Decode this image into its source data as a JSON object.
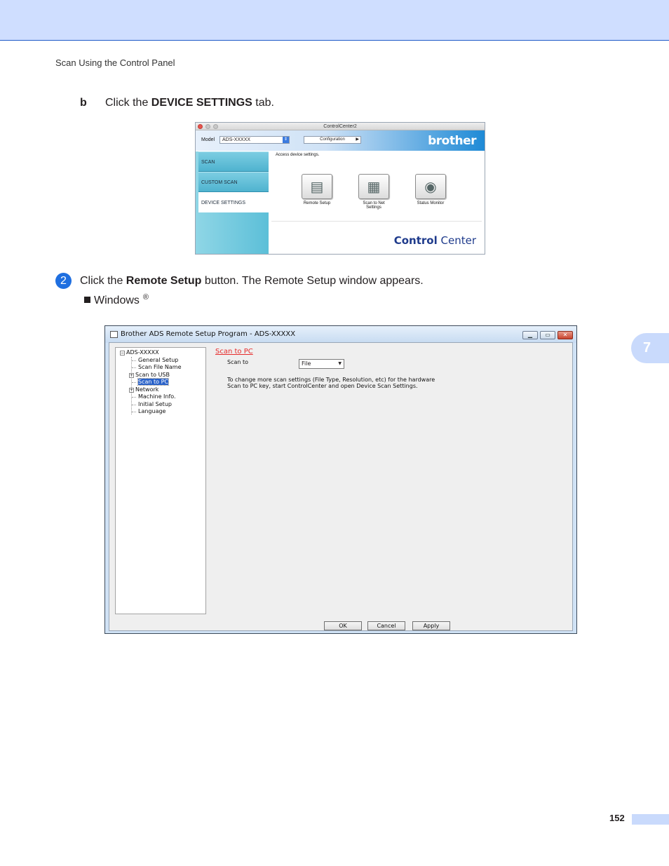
{
  "header": {
    "section_title": "Scan Using the Control Panel"
  },
  "step_b": {
    "marker": "b",
    "text_before": "Click the ",
    "bold": "DEVICE SETTINGS",
    "text_after": " tab."
  },
  "controlcenter": {
    "window_title": "ControlCenter2",
    "model_label": "Model",
    "model_value": "ADS-XXXXX",
    "configuration_label": "Configuration",
    "brand": "brother",
    "tabs": [
      "SCAN",
      "CUSTOM SCAN",
      "DEVICE SETTINGS"
    ],
    "active_tab": "DEVICE SETTINGS",
    "description": "Access device settings.",
    "buttons": [
      {
        "label_line1": "Remote Setup",
        "label_line2": ""
      },
      {
        "label_line1": "Scan to Net",
        "label_line2": "Settings"
      },
      {
        "label_line1": "Status Monitor",
        "label_line2": ""
      }
    ],
    "logo_bold": "Control",
    "logo_rest": " Center"
  },
  "step_2": {
    "number": "2",
    "text_before": "Click the ",
    "bold": "Remote Setup",
    "text_after": " button. The Remote Setup window appears.",
    "bullet_label": "Windows",
    "bullet_sup": "®"
  },
  "remote_setup": {
    "window_title": "Brother ADS Remote Setup Program - ADS-XXXXX",
    "tree": {
      "root": "ADS-XXXXX",
      "items": [
        "General Setup",
        "Scan File Name",
        "Scan to USB",
        "Scan to PC",
        "Network",
        "Machine Info.",
        "Initial Setup",
        "Language"
      ],
      "selected": "Scan to PC"
    },
    "pane_title": "Scan to PC",
    "scan_to_label": "Scan to",
    "scan_to_value": "File",
    "description_line1": "To change more scan settings (File Type, Resolution, etc) for the hardware",
    "description_line2": "Scan to PC key, start ControlCenter and open Device Scan Settings.",
    "buttons": {
      "ok": "OK",
      "cancel": "Cancel",
      "apply": "Apply"
    }
  },
  "chapter_tab": "7",
  "page_number": "152"
}
